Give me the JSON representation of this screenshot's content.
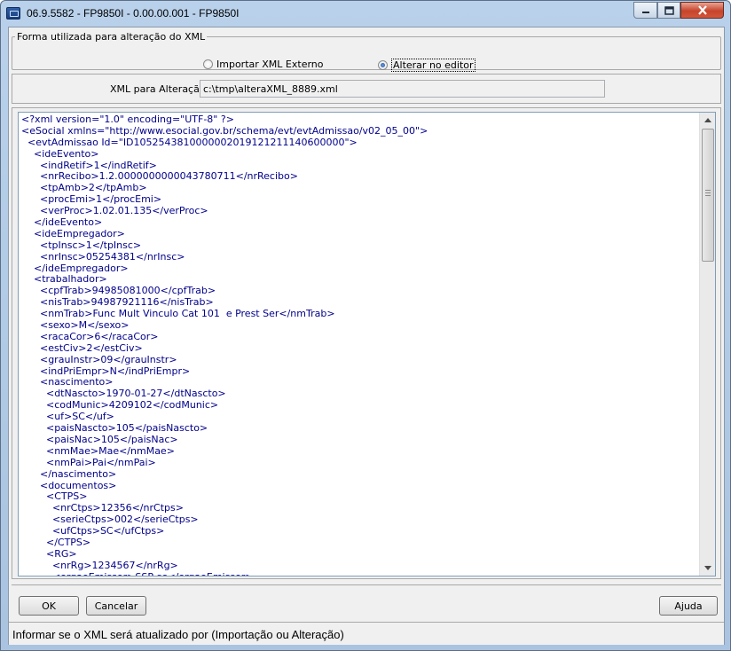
{
  "window": {
    "title": "06.9.5582 - FP9850I - 0.00.00.001 - FP9850I"
  },
  "group": {
    "legend": "Forma utilizada para alteração do XML",
    "options": [
      {
        "label": "Importar XML Externo",
        "selected": false
      },
      {
        "label": "Alterar no editor",
        "selected": true
      }
    ]
  },
  "xml_path": {
    "label": "XML para Alteração:",
    "value": "c:\\tmp\\alteraXML_8889.xml"
  },
  "editor": {
    "lines": [
      "<?xml version=\"1.0\" encoding=\"UTF-8\" ?>",
      "<eSocial xmlns=\"http://www.esocial.gov.br/schema/evt/evtAdmissao/v02_05_00\">",
      "  <evtAdmissao Id=\"ID1052543810000002019121211140600000\">",
      "    <ideEvento>",
      "      <indRetif>1</indRetif>",
      "      <nrRecibo>1.2.0000000000043780711</nrRecibo>",
      "      <tpAmb>2</tpAmb>",
      "      <procEmi>1</procEmi>",
      "      <verProc>1.02.01.135</verProc>",
      "    </ideEvento>",
      "    <ideEmpregador>",
      "      <tpInsc>1</tpInsc>",
      "      <nrInsc>05254381</nrInsc>",
      "    </ideEmpregador>",
      "    <trabalhador>",
      "      <cpfTrab>94985081000</cpfTrab>",
      "      <nisTrab>94987921116</nisTrab>",
      "      <nmTrab>Func Mult Vinculo Cat 101  e Prest Ser</nmTrab>",
      "      <sexo>M</sexo>",
      "      <racaCor>6</racaCor>",
      "      <estCiv>2</estCiv>",
      "      <grauInstr>09</grauInstr>",
      "      <indPriEmpr>N</indPriEmpr>",
      "      <nascimento>",
      "        <dtNascto>1970-01-27</dtNascto>",
      "        <codMunic>4209102</codMunic>",
      "        <uf>SC</uf>",
      "        <paisNascto>105</paisNascto>",
      "        <paisNac>105</paisNac>",
      "        <nmMae>Mae</nmMae>",
      "        <nmPai>Pai</nmPai>",
      "      </nascimento>",
      "      <documentos>",
      "        <CTPS>",
      "          <nrCtps>12356</nrCtps>",
      "          <serieCtps>002</serieCtps>",
      "          <ufCtps>SC</ufCtps>",
      "        </CTPS>",
      "        <RG>",
      "          <nrRg>1234567</nrRg>",
      "          <orgaoEmissor>SSP-sc</orgaoEmissor>"
    ]
  },
  "buttons": {
    "ok": "OK",
    "cancel": "Cancelar",
    "help": "Ajuda"
  },
  "status": {
    "text": "Informar se o XML será atualizado por (Importação ou Alteração)"
  }
}
